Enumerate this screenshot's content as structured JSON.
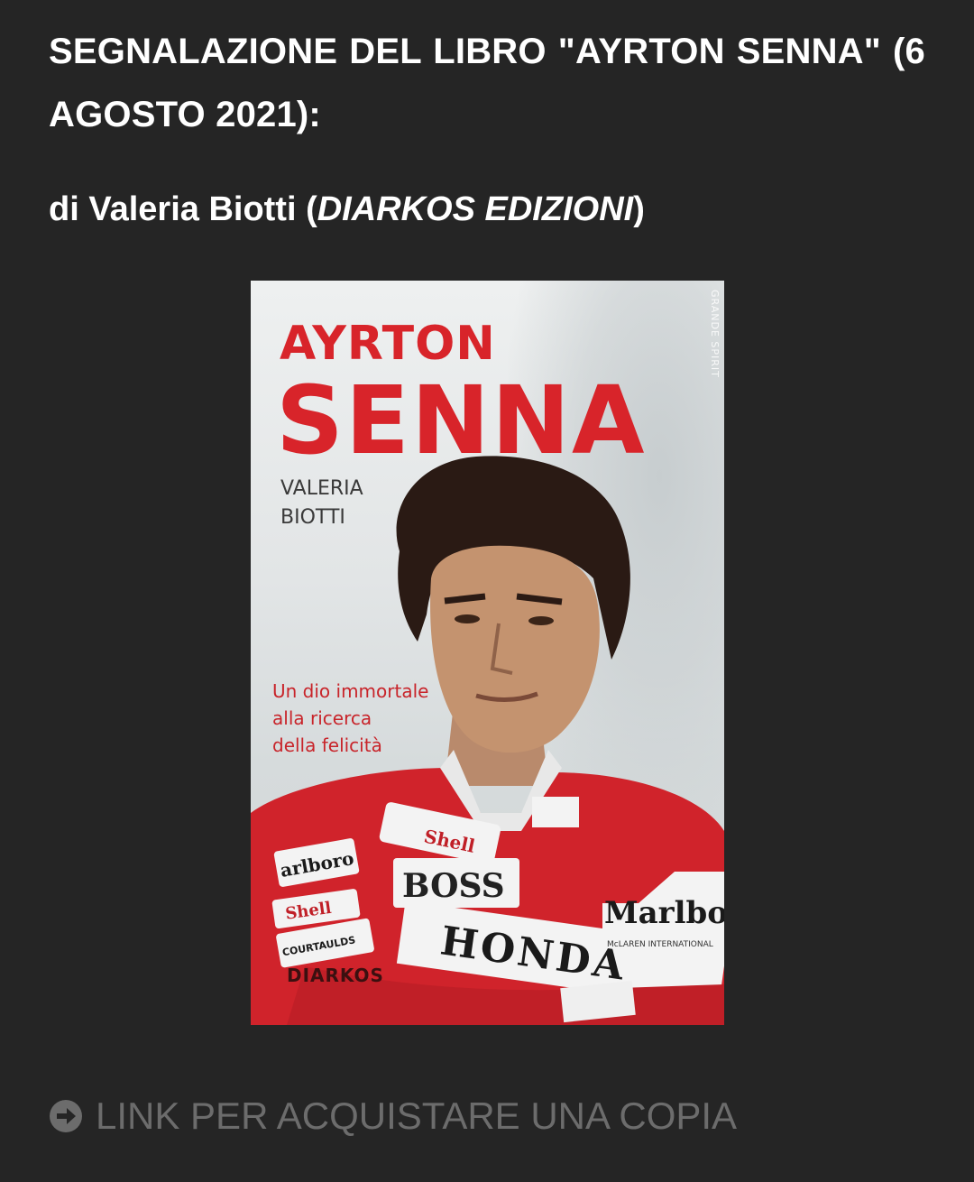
{
  "post": {
    "headline": "SEGNALAZIONE DEL LIBRO \"AYRTON SENNA\" (6 AGOSTO 2021):",
    "byline_prefix": "di Valeria Biotti (",
    "byline_publisher": "DIARKOS EDIZIONI",
    "byline_suffix": ")"
  },
  "book_cover": {
    "title_line1": "AYRTON",
    "title_line2": "SENNA",
    "author_line1": "VALERIA",
    "author_line2": "BIOTTI",
    "tagline_line1": "Un dio immortale",
    "tagline_line2": "alla ricerca",
    "tagline_line3": "della felicità",
    "publisher": "DIARKOS",
    "spine_text": "GRANDE SPIRIT",
    "suit_sponsors": {
      "shell": "Shell",
      "boss": "BOSS",
      "marlboro_left": "arlboro",
      "marlboro_right": "Marlboro",
      "shell_sleeve": "Shell",
      "courtaulds": "COURTAULDS",
      "honda": "HONDA",
      "mclaren": "McLAREN INTERNATIONAL"
    }
  },
  "buy_link": {
    "icon": "arrow-circle-right-icon",
    "label": "LINK PER ACQUISTARE UNA COPIA"
  },
  "colors": {
    "background": "#252525",
    "text": "#ffffff",
    "link": "#6c6c6c",
    "cover_red": "#d8242a"
  }
}
